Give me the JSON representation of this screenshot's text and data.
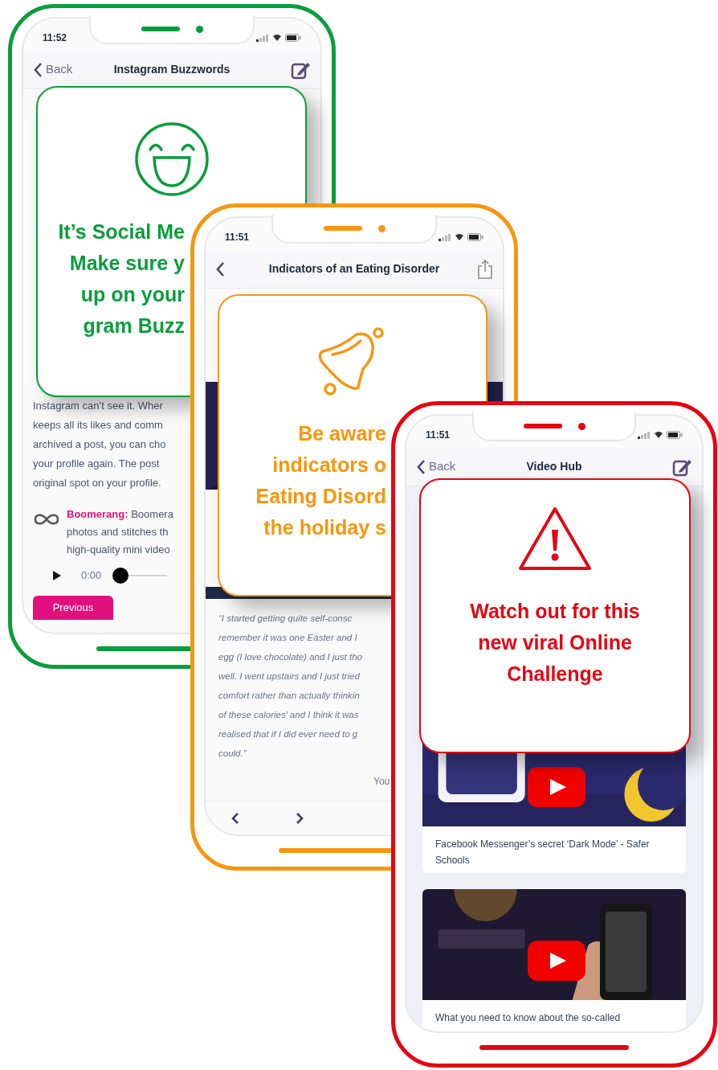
{
  "phones": [
    {
      "kind": "article",
      "color": "#0a9d3c",
      "status_time": "11:52",
      "nav": {
        "back": "Back",
        "title": "Instagram Buzzwords",
        "kind": "edit"
      },
      "alert": {
        "kind": "smile",
        "lines": [
          "It’s Social Me",
          "Make sure y",
          "up on your",
          "gram Buzz"
        ]
      },
      "article": {
        "lines": [
          "Instagram can’t see it. Wher",
          "keeps all its likes and comm",
          "archived a post, you can cho",
          "your profile again. The post",
          "original spot on your profile."
        ],
        "term": "Boomerang:",
        "term_lines": [
          " Boomera",
          "photos and stitches th",
          "high-quality mini video"
        ],
        "audio": {
          "time": "0:00",
          "level": 0
        },
        "button": "Previous"
      }
    },
    {
      "kind": "story",
      "color": "#f7960f",
      "status_time": "11:51",
      "nav": {
        "title": "Indicators of an Eating Disorder",
        "kind": "share"
      },
      "alert": {
        "kind": "bell",
        "lines": [
          "Be aware",
          "indicators o",
          "Eating Disord",
          "the holiday s"
        ]
      },
      "story": {
        "quote_lines": [
          "“I started getting quite self-consc",
          "remember it was one Easter and I",
          "egg (I love chocolate) and I just tho",
          "well. I went upstairs and I just tried",
          "comfort rather than actually thinkin",
          "of these calories’ and I think it was",
          "realised that if I did ever need to g",
          "could.”"
        ],
        "attribution": "You"
      }
    },
    {
      "kind": "video_hub",
      "color": "#e30613",
      "status_time": "11:51",
      "nav": {
        "back": "Back",
        "title": "Video Hub",
        "kind": "edit"
      },
      "alert": {
        "kind": "warning",
        "lines": [
          "Watch out for this",
          "new viral Online",
          "Challenge"
        ]
      },
      "videos": [
        {
          "kind": "night",
          "caption": "Facebook Messenger’s secret ‘Dark Mode’ - Safer Schools"
        },
        {
          "kind": "hand",
          "caption": "What you need to know about the so-called"
        }
      ]
    }
  ]
}
